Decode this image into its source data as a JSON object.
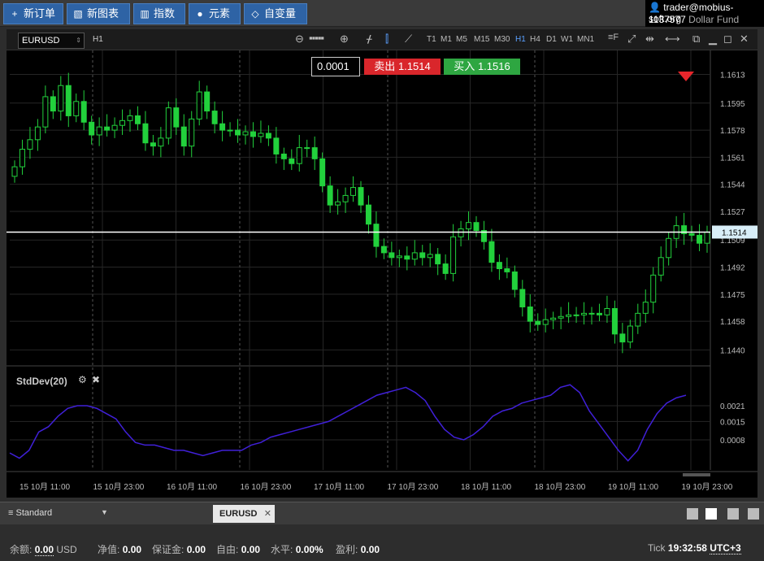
{
  "toolbar": {
    "buttons": [
      {
        "icon": "+",
        "label": "新订单"
      },
      {
        "icon": "▧",
        "label": "新图表"
      },
      {
        "icon": "▥",
        "label": "指数"
      },
      {
        "icon": "●",
        "label": "元素"
      },
      {
        "icon": "◇",
        "label": "自变量"
      }
    ]
  },
  "account": {
    "user": "trader@mobius-soft.org",
    "number": "1137577",
    "fund": "Dollar Fund"
  },
  "chart_header": {
    "symbol": "EURUSD",
    "timeframe": "H1",
    "timeframes": [
      "T1",
      "M1",
      "M5",
      "M15",
      "M30",
      "H1",
      "H4",
      "D1",
      "W1",
      "MN1"
    ],
    "active_timeframe": "H1"
  },
  "trade": {
    "volume": "0.0001",
    "sell_label": "卖出",
    "sell_price": "1.1514",
    "buy_label": "买入",
    "buy_price": "1.1516"
  },
  "indicator": {
    "label": "StdDev(20)"
  },
  "current_price": "1.1514",
  "colors": {
    "bull": "#22d13c",
    "bear": "#22d13c",
    "stddev_line": "#4020d8",
    "sell": "#d9262b",
    "buy": "#2ea641",
    "accent": "#2e63a5"
  },
  "chart_data": [
    {
      "type": "candlestick",
      "symbol": "EURUSD",
      "timeframe": "H1",
      "y_ticks": [
        "1.1613",
        "1.1595",
        "1.1578",
        "1.1561",
        "1.1544",
        "1.1527",
        "1.1509",
        "1.1492",
        "1.1475",
        "1.1458",
        "1.1440"
      ],
      "ylim": [
        1.143,
        1.1625
      ],
      "x_ticks": [
        "15 10月 11:00",
        "15 10月 23:00",
        "16 10月 11:00",
        "16 10月 23:00",
        "17 10月 11:00",
        "17 10月 23:00",
        "18 10月 11:00",
        "18 10月 23:00",
        "19 10月 11:00",
        "19 10月 23:00"
      ],
      "close": [
        1.1555,
        1.1566,
        1.1572,
        1.158,
        1.1599,
        1.159,
        1.1606,
        1.1587,
        1.1596,
        1.1583,
        1.1575,
        1.158,
        1.1578,
        1.1581,
        1.1584,
        1.1587,
        1.1582,
        1.157,
        1.1568,
        1.1573,
        1.1592,
        1.158,
        1.1568,
        1.1585,
        1.1602,
        1.159,
        1.1582,
        1.1578,
        1.1578,
        1.1575,
        1.1577,
        1.1574,
        1.1576,
        1.1573,
        1.1563,
        1.156,
        1.1557,
        1.1567,
        1.1567,
        1.156,
        1.1543,
        1.1531,
        1.1533,
        1.1537,
        1.1542,
        1.1531,
        1.1519,
        1.1505,
        1.1501,
        1.1498,
        1.1499,
        1.1497,
        1.1501,
        1.1498,
        1.15,
        1.1494,
        1.1488,
        1.1511,
        1.1516,
        1.152,
        1.1515,
        1.1508,
        1.1495,
        1.1491,
        1.1489,
        1.1478,
        1.1467,
        1.1458,
        1.1456,
        1.1459,
        1.146,
        1.1461,
        1.1462,
        1.1462,
        1.1463,
        1.1463,
        1.1462,
        1.1466,
        1.145,
        1.1445,
        1.1455,
        1.1463,
        1.147,
        1.1487,
        1.1498,
        1.151,
        1.1518,
        1.1513,
        1.1512,
        1.1507,
        1.1514
      ],
      "series": [
        {
          "name": "StdDev(20)",
          "y_ticks": [
            "0.0021",
            "0.0015",
            "0.0008"
          ],
          "values": [
            0.0003,
            0.0001,
            0.0004,
            0.0011,
            0.0013,
            0.0017,
            0.002,
            0.0021,
            0.0021,
            0.002,
            0.0018,
            0.0016,
            0.0011,
            0.0007,
            0.0006,
            0.0006,
            0.0005,
            0.0004,
            0.0004,
            0.0003,
            0.0002,
            0.0003,
            0.0004,
            0.0004,
            0.0004,
            0.0006,
            0.0007,
            0.0009,
            0.001,
            0.0011,
            0.0012,
            0.0013,
            0.0014,
            0.0015,
            0.0017,
            0.0019,
            0.0021,
            0.0023,
            0.0025,
            0.0026,
            0.0027,
            0.0028,
            0.0026,
            0.0023,
            0.0017,
            0.0012,
            0.0009,
            0.0008,
            0.001,
            0.0013,
            0.0017,
            0.0019,
            0.002,
            0.0022,
            0.0023,
            0.0024,
            0.0025,
            0.0028,
            0.0029,
            0.0026,
            0.0019,
            0.0014,
            0.0009,
            0.0004,
            0.0,
            0.0004,
            0.0012,
            0.0018,
            0.0022,
            0.0024,
            0.0025
          ]
        }
      ]
    }
  ],
  "tabbar": {
    "workspace": "Standard",
    "tab": "EURUSD"
  },
  "status": {
    "balance_label": "余额:",
    "balance": "0.00",
    "currency": "USD",
    "equity_label": "净值:",
    "equity": "0.00",
    "margin_label": "保证金:",
    "margin": "0.00",
    "free_label": "自由:",
    "free": "0.00",
    "level_label": "水平:",
    "level": "0.00%",
    "profit_label": "盈利:",
    "profit": "0.00",
    "tick_label": "Tick",
    "time": "19:32:58",
    "tz": "UTC+3"
  }
}
